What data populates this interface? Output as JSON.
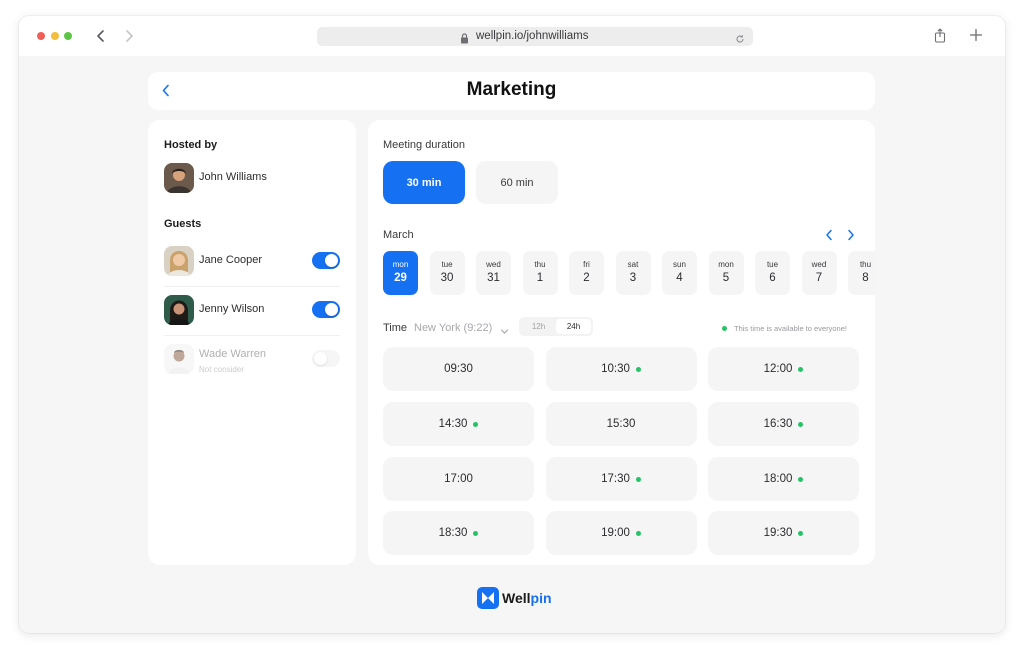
{
  "browser": {
    "url": "wellpin.io/johnwilliams",
    "buttons": {
      "back": "chevron-left-icon",
      "forward": "chevron-right-icon",
      "share": "share-icon",
      "new_tab": "plus-icon"
    }
  },
  "header": {
    "title": "Marketing"
  },
  "host": {
    "label": "Hosted by",
    "name": "John Williams"
  },
  "guests": {
    "label": "Guests",
    "items": [
      {
        "name": "Jane Cooper",
        "sub": "",
        "enabled": true
      },
      {
        "name": "Jenny Wilson",
        "sub": "",
        "enabled": true
      },
      {
        "name": "Wade Warren",
        "sub": "Not consider",
        "enabled": false
      }
    ]
  },
  "duration": {
    "label": "Meeting duration",
    "options": [
      "30 min",
      "60 min"
    ],
    "selected": "30 min"
  },
  "calendar": {
    "month": "March",
    "days": [
      {
        "name": "mon",
        "num": "29",
        "selected": true
      },
      {
        "name": "tue",
        "num": "30"
      },
      {
        "name": "wed",
        "num": "31"
      },
      {
        "name": "thu",
        "num": "1"
      },
      {
        "name": "fri",
        "num": "2"
      },
      {
        "name": "sat",
        "num": "3"
      },
      {
        "name": "sun",
        "num": "4"
      },
      {
        "name": "mon",
        "num": "5"
      },
      {
        "name": "tue",
        "num": "6"
      },
      {
        "name": "wed",
        "num": "7"
      },
      {
        "name": "thu",
        "num": "8"
      }
    ]
  },
  "time": {
    "label": "Time",
    "timezone": "New York (9:22)",
    "formats": [
      "12h",
      "24h"
    ],
    "selected_format": "24h",
    "availability_note": "This time is available to everyone!"
  },
  "slots": [
    {
      "time": "09:30",
      "available": false
    },
    {
      "time": "10:30",
      "available": true
    },
    {
      "time": "12:00",
      "available": true
    },
    {
      "time": "14:30",
      "available": true
    },
    {
      "time": "15:30",
      "available": false
    },
    {
      "time": "16:30",
      "available": true
    },
    {
      "time": "17:00",
      "available": false
    },
    {
      "time": "17:30",
      "available": true
    },
    {
      "time": "18:00",
      "available": true
    },
    {
      "time": "18:30",
      "available": true
    },
    {
      "time": "19:00",
      "available": true
    },
    {
      "time": "19:30",
      "available": true
    }
  ],
  "brand": {
    "part1": "Well",
    "part2": "pin"
  },
  "colors": {
    "accent": "#1671f2",
    "available": "#26c266",
    "surface": "#f5f5f6"
  }
}
